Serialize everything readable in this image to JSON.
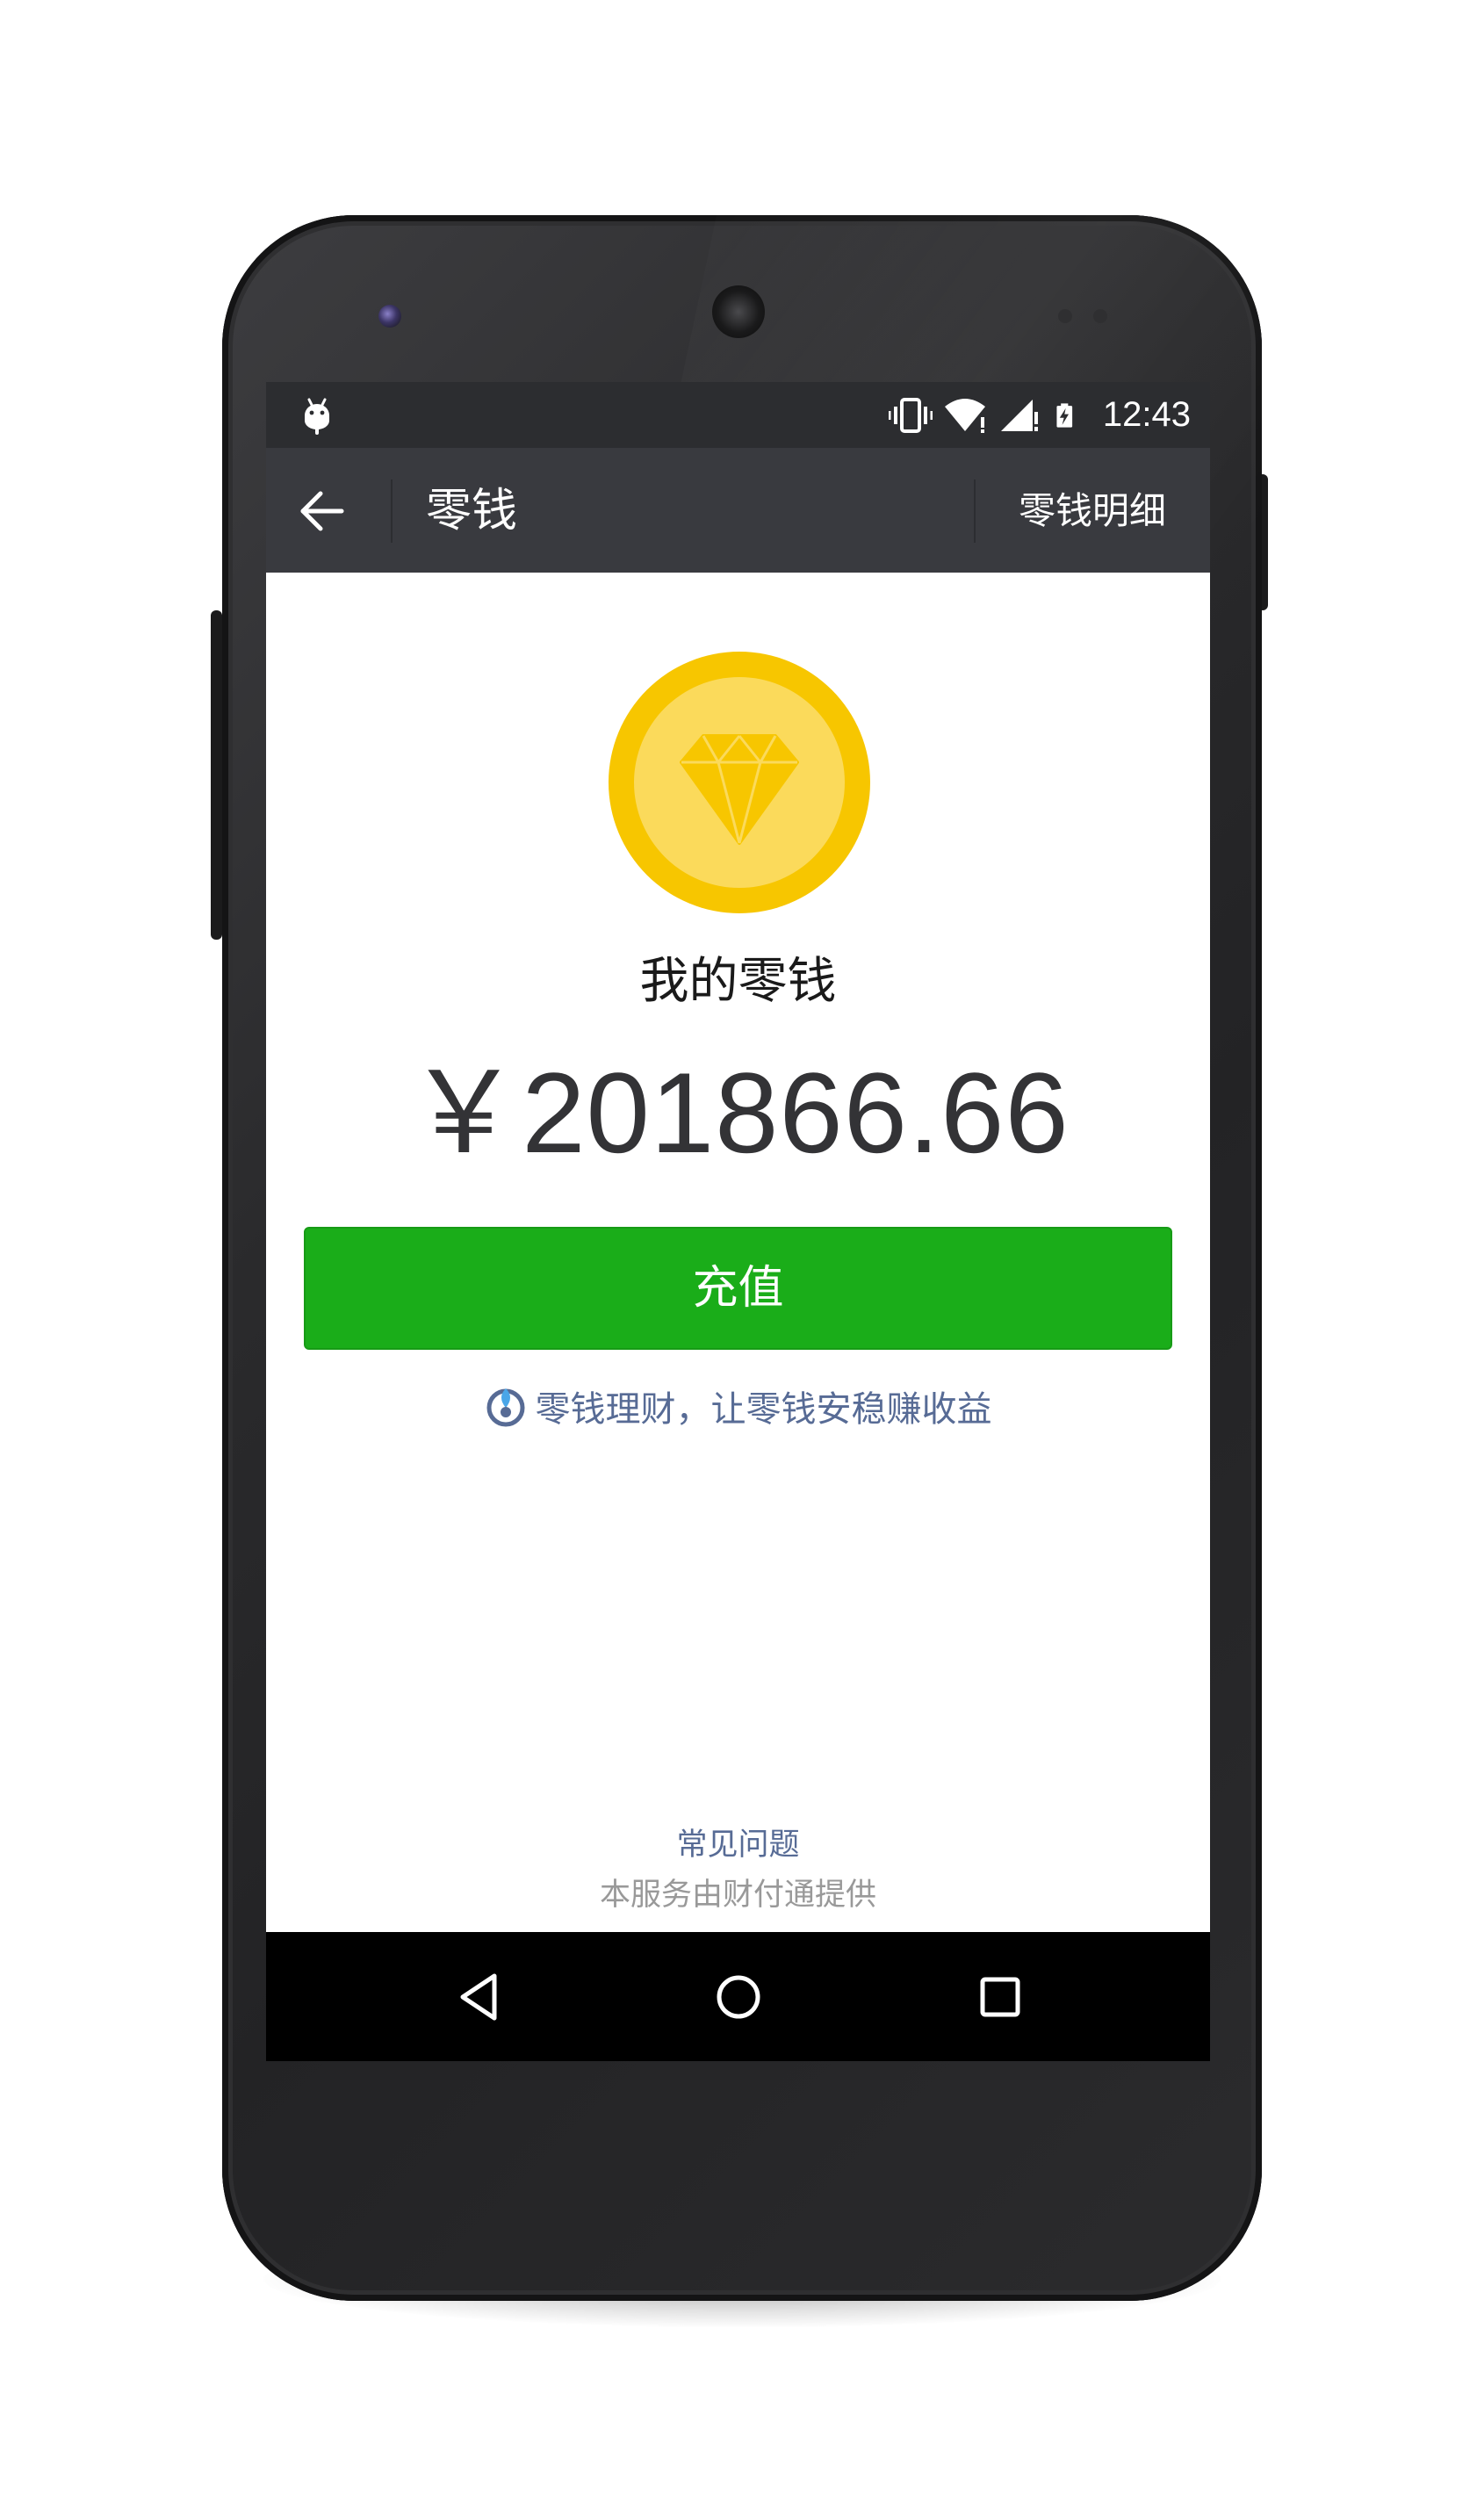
{
  "status_bar": {
    "time": "12:43",
    "icons": [
      "android-debug-icon",
      "vibrate-icon",
      "wifi-icon",
      "signal-icon",
      "battery-charging-icon"
    ]
  },
  "action_bar": {
    "title": "零钱",
    "right_link": "零钱明细",
    "back_icon": "arrow-left-icon"
  },
  "wallet": {
    "icon": "diamond-coin-icon",
    "label": "我的零钱",
    "amount": "￥201866.66",
    "topup_button": "充值",
    "licai_link": "零钱理财，让零钱安稳赚收益",
    "licai_icon": "licaitong-icon"
  },
  "footer": {
    "faq": "常见问题",
    "provider": "本服务由财付通提供"
  },
  "nav_bar": {
    "icons": [
      "back-triangle-icon",
      "home-circle-icon",
      "recent-square-icon"
    ]
  },
  "colors": {
    "status_bar": "#2c2d30",
    "action_bar": "#393a3f",
    "primary_button": "#1aad19",
    "link": "#576b95",
    "coin_outer": "#f7c600",
    "coin_inner": "#fbda5b",
    "muted_text": "#999999"
  }
}
